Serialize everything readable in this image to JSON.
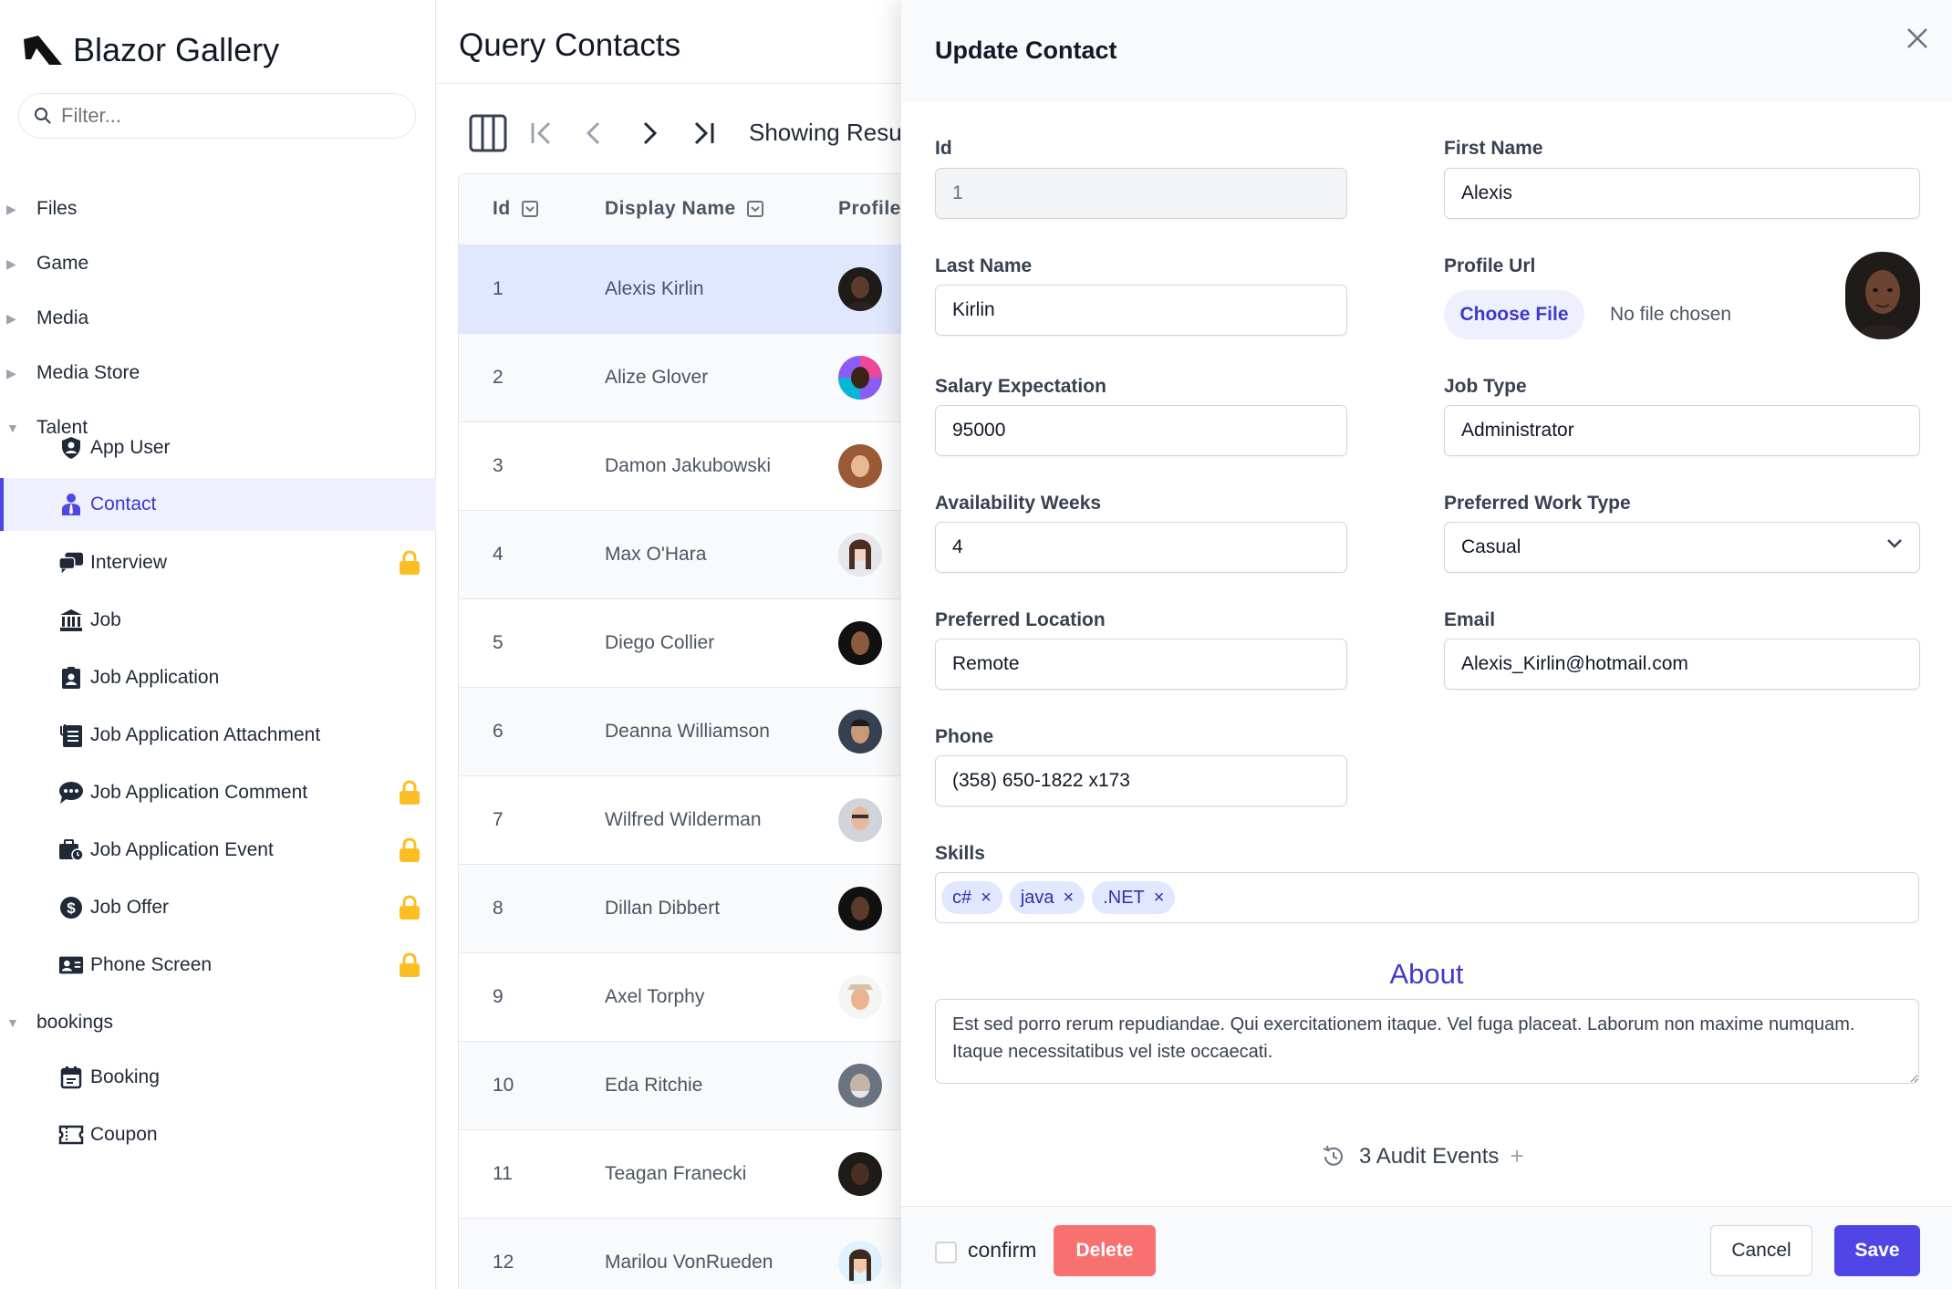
{
  "brand": {
    "name": "Blazor Gallery"
  },
  "sidebar": {
    "filter_placeholder": "Filter...",
    "groups": [
      {
        "label": "Files"
      },
      {
        "label": "Game"
      },
      {
        "label": "Media"
      },
      {
        "label": "Media Store"
      },
      {
        "label": "Talent"
      },
      {
        "label": "bookings"
      }
    ],
    "talent_items": [
      {
        "label": "App User",
        "icon": "shield-user-icon",
        "locked": false
      },
      {
        "label": "Contact",
        "icon": "contact-icon",
        "locked": false,
        "active": true
      },
      {
        "label": "Interview",
        "icon": "chat-icon",
        "locked": true
      },
      {
        "label": "Job",
        "icon": "bank-icon",
        "locked": false
      },
      {
        "label": "Job Application",
        "icon": "id-badge-icon",
        "locked": false
      },
      {
        "label": "Job Application Attachment",
        "icon": "attachment-doc-icon",
        "locked": false
      },
      {
        "label": "Job Application Comment",
        "icon": "comment-icon",
        "locked": true
      },
      {
        "label": "Job Application Event",
        "icon": "briefcase-clock-icon",
        "locked": true
      },
      {
        "label": "Job Offer",
        "icon": "dollar-icon",
        "locked": true
      },
      {
        "label": "Phone Screen",
        "icon": "contact-card-icon",
        "locked": true
      }
    ],
    "booking_items": [
      {
        "label": "Booking",
        "icon": "calendar-icon"
      },
      {
        "label": "Coupon",
        "icon": "ticket-icon"
      }
    ]
  },
  "main": {
    "title": "Query Contacts",
    "showing": "Showing Resu",
    "columns": {
      "id": "Id",
      "name": "Display Name",
      "profile": "Profile"
    },
    "rows": [
      {
        "id": "1",
        "name": "Alexis Kirlin"
      },
      {
        "id": "2",
        "name": "Alize Glover"
      },
      {
        "id": "3",
        "name": "Damon Jakubowski"
      },
      {
        "id": "4",
        "name": "Max O'Hara"
      },
      {
        "id": "5",
        "name": "Diego Collier"
      },
      {
        "id": "6",
        "name": "Deanna Williamson"
      },
      {
        "id": "7",
        "name": "Wilfred Wilderman"
      },
      {
        "id": "8",
        "name": "Dillan Dibbert"
      },
      {
        "id": "9",
        "name": "Axel Torphy"
      },
      {
        "id": "10",
        "name": "Eda Ritchie"
      },
      {
        "id": "11",
        "name": "Teagan Franecki"
      },
      {
        "id": "12",
        "name": "Marilou VonRueden"
      }
    ]
  },
  "panel": {
    "title": "Update Contact",
    "labels": {
      "id": "Id",
      "first_name": "First Name",
      "last_name": "Last Name",
      "profile_url": "Profile Url",
      "salary": "Salary Expectation",
      "job_type": "Job Type",
      "availability": "Availability Weeks",
      "work_type": "Preferred Work Type",
      "location": "Preferred Location",
      "email": "Email",
      "phone": "Phone",
      "skills": "Skills"
    },
    "values": {
      "id": "1",
      "first_name": "Alexis",
      "last_name": "Kirlin",
      "salary": "95000",
      "job_type": "Administrator",
      "availability": "4",
      "work_type": "Casual",
      "location": "Remote",
      "email": "Alexis_Kirlin@hotmail.com",
      "phone": "(358) 650-1822 x173"
    },
    "choose_file": "Choose File",
    "no_file": "No file chosen",
    "skills": [
      "c#",
      "java",
      ".NET"
    ],
    "about_heading": "About",
    "about_text": "Est sed porro rerum repudiandae. Qui exercitationem itaque. Vel fuga placeat. Laborum non maxime numquam. Itaque necessitatibus vel iste occaecati.",
    "audit": "3 Audit Events",
    "confirm": "confirm",
    "delete": "Delete",
    "cancel": "Cancel",
    "save": "Save"
  },
  "colors": {
    "accent": "#4f46e5",
    "danger": "#f87171",
    "lock": "#fbbf24",
    "selected_row": "#e0e7ff"
  }
}
